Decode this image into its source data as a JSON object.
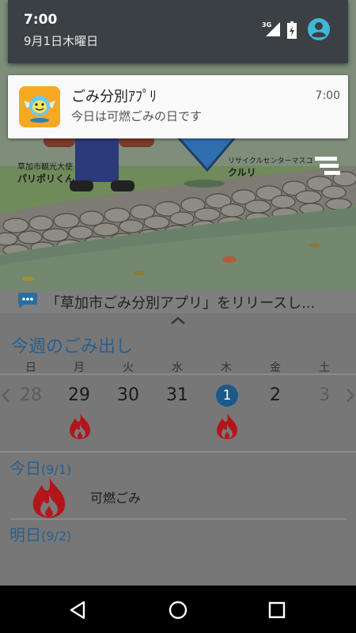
{
  "status_bar": {
    "time": "7:00",
    "date": "9月1日木曜日",
    "network": "3G",
    "icons": [
      "signal-icon",
      "battery-icon",
      "account-icon"
    ]
  },
  "notification": {
    "app_name": "ごみ分別ｱﾌﾟﾘ",
    "message": "今日は可燃ごみの日です",
    "time": "7:00",
    "icon": "app-mascot-icon"
  },
  "banner": {
    "mascot_a_title": "草加市観光大使",
    "mascot_a_name": "パリポリくん",
    "mascot_b_title": "リサイクルセンターマスコ",
    "mascot_b_name": "クルリ"
  },
  "news": {
    "text": "「草加市ごみ分別アプリ」をリリースし..."
  },
  "week": {
    "title": "今週のごみ出し",
    "days": [
      "日",
      "月",
      "火",
      "水",
      "木",
      "金",
      "土"
    ],
    "dates": [
      "28",
      "29",
      "30",
      "31",
      "1",
      "2",
      "3"
    ],
    "today_index": 4,
    "burnable_days": [
      1,
      4
    ]
  },
  "today": {
    "label": "今日",
    "date": "(9/1)",
    "garbage": "可燃ごみ"
  },
  "tomorrow": {
    "label": "明日",
    "date": "(9/2)"
  },
  "colors": {
    "accent": "#2a5f8b",
    "today_circle": "#1b5a88",
    "fire": "#b2161b",
    "app_icon_bg": "#f7a823",
    "status_bar": "#3b4044"
  }
}
